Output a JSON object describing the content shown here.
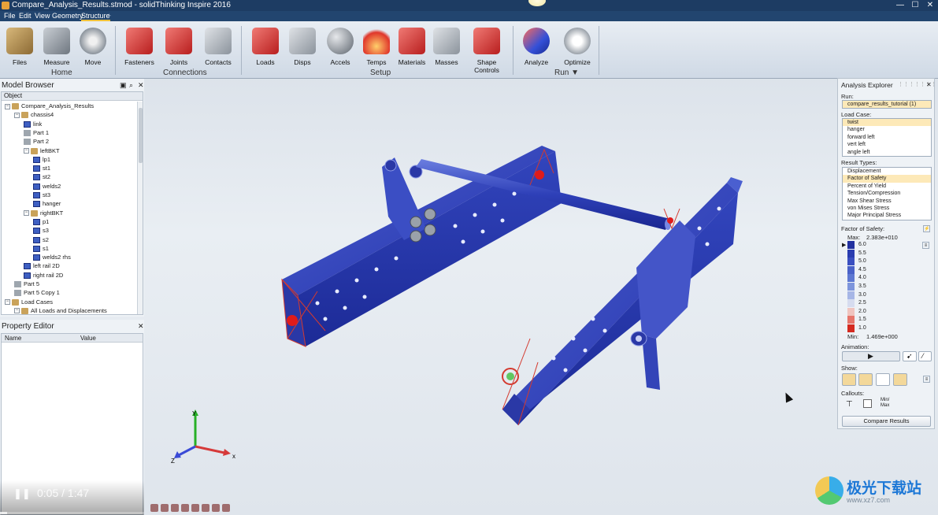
{
  "title_bar": {
    "title": "Compare_Analysis_Results.stmod - solidThinking Inspire 2016"
  },
  "window_buttons": {
    "minimize": "—",
    "maximize": "☐",
    "close": "✕"
  },
  "menu": [
    "File",
    "Edit",
    "View",
    "Geometry",
    "Structure",
    "+"
  ],
  "ribbon": {
    "tools": {
      "files": "Files",
      "measure": "Measure",
      "move": "Move",
      "fasteners": "Fasteners",
      "joints": "Joints",
      "contacts": "Contacts",
      "loads": "Loads",
      "disps": "Disps",
      "accels": "Accels",
      "temps": "Temps",
      "materials": "Materials",
      "masses": "Masses",
      "shape_controls": "Shape Controls",
      "analyze": "Analyze",
      "optimize": "Optimize"
    },
    "groups": {
      "home": "Home",
      "connections": "Connections",
      "setup": "Setup",
      "run": "Run ▼"
    }
  },
  "model_browser": {
    "title": "Model Browser",
    "column": "Object",
    "tree": [
      {
        "label": "Compare_Analysis_Results",
        "level": 0,
        "toggle": "−",
        "icon": "folder"
      },
      {
        "label": "chassis4",
        "level": 1,
        "toggle": "−",
        "icon": "folder"
      },
      {
        "label": "link",
        "level": 2,
        "toggle": "",
        "icon": "part"
      },
      {
        "label": "Part 1",
        "level": 2,
        "toggle": "",
        "icon": "grey"
      },
      {
        "label": "Part 2",
        "level": 2,
        "toggle": "",
        "icon": "grey"
      },
      {
        "label": "leftBKT",
        "level": 2,
        "toggle": "−",
        "icon": "folder"
      },
      {
        "label": "lp1",
        "level": 3,
        "toggle": "",
        "icon": "part"
      },
      {
        "label": "st1",
        "level": 3,
        "toggle": "",
        "icon": "part"
      },
      {
        "label": "st2",
        "level": 3,
        "toggle": "",
        "icon": "part"
      },
      {
        "label": "welds2",
        "level": 3,
        "toggle": "",
        "icon": "part"
      },
      {
        "label": "st3",
        "level": 3,
        "toggle": "",
        "icon": "part"
      },
      {
        "label": "hanger",
        "level": 3,
        "toggle": "",
        "icon": "part"
      },
      {
        "label": "rightBKT",
        "level": 2,
        "toggle": "−",
        "icon": "folder"
      },
      {
        "label": "p1",
        "level": 3,
        "toggle": "",
        "icon": "part"
      },
      {
        "label": "s3",
        "level": 3,
        "toggle": "",
        "icon": "part"
      },
      {
        "label": "s2",
        "level": 3,
        "toggle": "",
        "icon": "part"
      },
      {
        "label": "s1",
        "level": 3,
        "toggle": "",
        "icon": "part"
      },
      {
        "label": "welds2 rhs",
        "level": 3,
        "toggle": "",
        "icon": "part"
      },
      {
        "label": "left rail 2D",
        "level": 2,
        "toggle": "",
        "icon": "part"
      },
      {
        "label": "right rail 2D",
        "level": 2,
        "toggle": "",
        "icon": "part"
      },
      {
        "label": "Part 5",
        "level": 1,
        "toggle": "",
        "icon": "grey"
      },
      {
        "label": "Part 5 Copy 1",
        "level": 1,
        "toggle": "",
        "icon": "grey"
      },
      {
        "label": "Load Cases",
        "level": 0,
        "toggle": "−",
        "icon": "folder"
      },
      {
        "label": "All Loads and Displacements",
        "level": 1,
        "toggle": "−",
        "icon": "folder"
      }
    ]
  },
  "property_editor": {
    "title": "Property Editor",
    "col_name": "Name",
    "col_value": "Value"
  },
  "video": {
    "time": "0:05 / 1:47",
    "pause": "❚❚",
    "progress": 0.05
  },
  "axis_triad": {
    "x": "x",
    "y": "Y",
    "z": "Z"
  },
  "analysis_explorer": {
    "title": "Analysis Explorer",
    "run_label": "Run:",
    "run_value": "compare_results_tutorial (1)",
    "load_case_label": "Load Case:",
    "load_cases": [
      "twist",
      "hanger",
      "forward left",
      "vert left",
      "angle left"
    ],
    "load_case_selected": 0,
    "result_types_label": "Result Types:",
    "result_types": [
      "Displacement",
      "Factor of Safety",
      "Percent of Yield",
      "Tension/Compression",
      "Max Shear Stress",
      "von Mises Stress",
      "Major Principal Stress"
    ],
    "result_selected": 1,
    "legend_label": "Factor of Safety:",
    "max_label": "Max:",
    "max_value": "2.383e+010",
    "min_label": "Min:",
    "min_value": "1.469e+000",
    "legend_values": [
      "6.0",
      "5.5",
      "5.0",
      "4.5",
      "4.0",
      "3.5",
      "3.0",
      "2.5",
      "2.0",
      "1.5",
      "1.0"
    ],
    "legend_colors": [
      "#2231a0",
      "#2a3db0",
      "#3a4fc0",
      "#4a62c8",
      "#5e78d2",
      "#7d95dc",
      "#a6b6e6",
      "#d6dcef",
      "#f0c4bf",
      "#e6766c",
      "#d42a20"
    ],
    "animation_label": "Animation:",
    "show_label": "Show:",
    "callouts_label": "Callouts:",
    "minmax": "Min/\nMax",
    "compare_button": "Compare Results"
  },
  "watermark": {
    "name": "极光下载站",
    "url": "www.xz7.com"
  }
}
